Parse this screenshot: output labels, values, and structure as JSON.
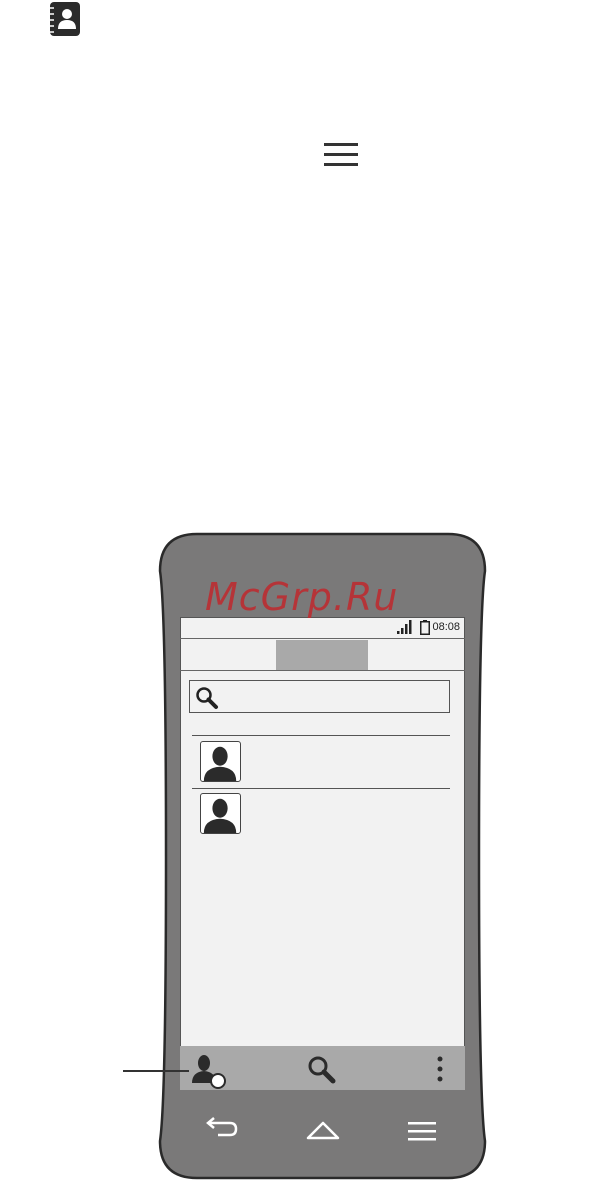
{
  "status_bar": {
    "time": "08:08"
  },
  "watermark": {
    "text": "McGrp.Ru"
  },
  "colors": {
    "phone_body": "#7a7979",
    "screen_bg": "#f2f2f2",
    "bar_gray": "#a9a9a9",
    "watermark": "#c0282d"
  },
  "icons": {
    "top": [
      "contacts-app-icon",
      "menu-icon"
    ],
    "status": [
      "signal-icon",
      "battery-icon"
    ],
    "bottom_bar": [
      "contact-add-icon",
      "search-icon",
      "more-vert-icon"
    ],
    "navigation": [
      "back-icon",
      "home-icon",
      "menu-icon"
    ]
  },
  "contacts": [
    {
      "avatar": "person-avatar-icon"
    },
    {
      "avatar": "person-avatar-icon"
    }
  ]
}
